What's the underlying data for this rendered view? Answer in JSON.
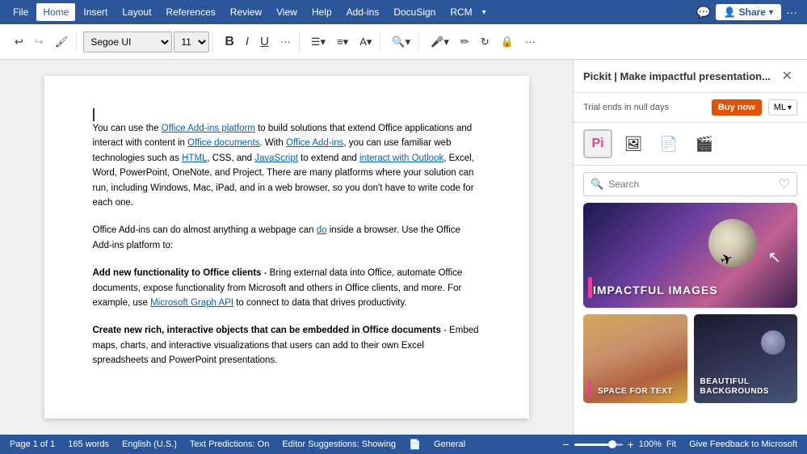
{
  "menu": {
    "items": [
      {
        "label": "File",
        "active": false
      },
      {
        "label": "Home",
        "active": true
      },
      {
        "label": "Insert",
        "active": false
      },
      {
        "label": "Layout",
        "active": false
      },
      {
        "label": "References",
        "active": false
      },
      {
        "label": "Review",
        "active": false
      },
      {
        "label": "View",
        "active": false
      },
      {
        "label": "Help",
        "active": false
      },
      {
        "label": "Add-ins",
        "active": false
      },
      {
        "label": "DocuSign",
        "active": false
      },
      {
        "label": "RCM",
        "active": false
      }
    ],
    "share_label": "Share",
    "share_icon": "👤"
  },
  "toolbar": {
    "font_family": "Segoe UI",
    "font_size": "11",
    "bold_label": "B",
    "italic_label": "I",
    "underline_label": "U",
    "more_label": "..."
  },
  "document": {
    "para1": "You can use the Office Add-ins platform to build solutions that extend Office applications and interact with content in Office documents. With Office Add-ins, you can use familiar web technologies such as HTML, CSS, and JavaScript to extend and interact with Outlook, Excel, Word, PowerPoint, OneNote, and Project. There are many platforms where your solution can run, including Windows, Mac, iPad, and in a web browser, so you don't have to write code for each one.",
    "para2": "Office Add-ins can do almost anything a webpage can do inside a browser. Use the Office Add-ins platform to:",
    "item1_bold": "Add new functionality to Office clients",
    "item1_rest": " - Bring external data into Office, automate Office documents, expose functionality from Microsoft and others in Office clients, and more. For example, use Microsoft Graph API to connect to data that drives productivity.",
    "item2_bold": "Create new rich, interactive objects that can be embedded in Office documents",
    "item2_rest": " - Embed maps, charts, and interactive visualizations that users can add to their own Excel spreadsheets and PowerPoint presentations."
  },
  "sidebar": {
    "title": "Pickit | Make impactful presentation...",
    "trial_text": "Trial ends in null days",
    "buy_label": "Buy now",
    "ml_label": "ML",
    "search_placeholder": "Search",
    "featured_label": "IMPACTFUL IMAGES",
    "thumb1_label": "SPACE FOR TEXT",
    "thumb2_label": "BEAUTIFUL BACKGROUNDS",
    "heart_icon": "♡"
  },
  "status_bar": {
    "page": "Page 1 of 1",
    "words": "165 words",
    "language": "English (U.S.)",
    "text_predictions": "Text Predictions: On",
    "editor_suggestions": "Editor Suggestions: Showing",
    "general": "General",
    "zoom": "100%",
    "fit": "Fit",
    "feedback": "Give Feedback to Microsoft"
  }
}
